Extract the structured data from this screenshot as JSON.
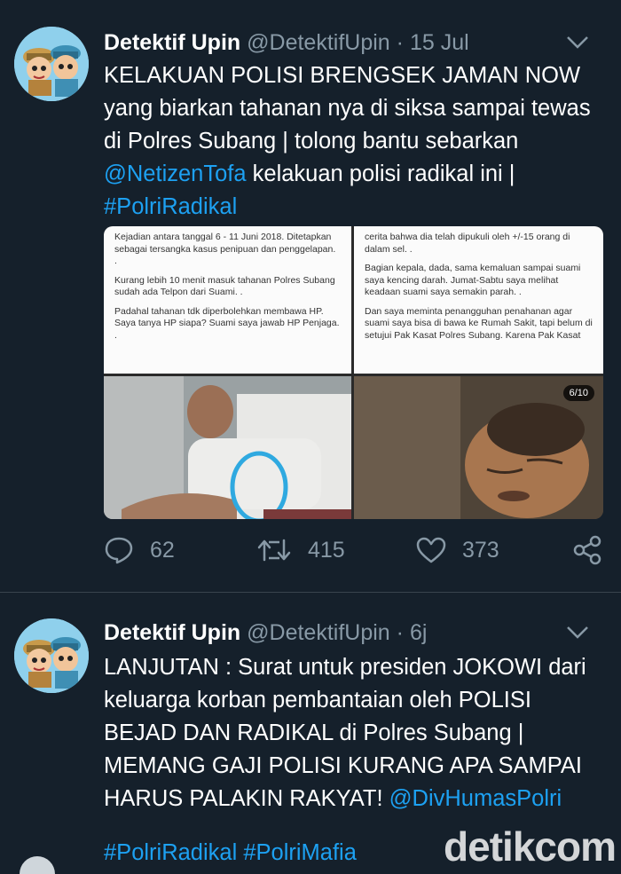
{
  "tweets": [
    {
      "name": "Detektif Upin",
      "handle": "@DetektifUpin",
      "separator": "·",
      "time": "15 Jul",
      "text_parts": {
        "p1": "KELAKUAN POLISI BRENGSEK JAMAN NOW yang biarkan tahanan nya di siksa sampai tewas di Polres Subang | tolong bantu sebarkan ",
        "mention": "@NetizenTofa",
        "p2": " kelakuan polisi radikal ini | ",
        "hashtag": "#PolriRadikal"
      },
      "media": {
        "left_panel": [
          "Kejadian antara tanggal 6 - 11 Juni 2018. Ditetapkan sebagai tersangka kasus penipuan dan penggelapan. .",
          "Kurang lebih 10 menit masuk tahanan Polres Subang sudah ada Telpon dari Suami. .",
          "Padahal tahanan tdk diperbolehkan membawa HP. Saya tanya HP siapa? Suami saya jawab HP Penjaga. ."
        ],
        "right_panel": [
          "cerita bahwa dia telah dipukuli oleh +/-15 orang di dalam sel. .",
          "Bagian kepala, dada, sama kemaluan sampai suami saya kencing darah. Jumat-Sabtu saya melihat keadaan suami saya semakin parah. .",
          "Dan saya meminta penangguhan penahanan agar suami saya bisa di bawa ke Rumah Sakit, tapi belum di setujui Pak Kasat Polres Subang. Karena Pak Kasat"
        ],
        "counter": "6/10"
      },
      "actions": {
        "replies": "62",
        "retweets": "415",
        "likes": "373"
      }
    },
    {
      "name": "Detektif Upin",
      "handle": "@DetektifUpin",
      "separator": "·",
      "time": "6j",
      "text_parts": {
        "p1": "LANJUTAN : Surat untuk presiden JOKOWI dari keluarga korban pembantaian oleh POLISI BEJAD DAN RADIKAL di Polres Subang | MEMANG GAJI POLISI KURANG APA SAMPAI HARUS PALAKIN RAKYAT! ",
        "mention": "@DivHumasPolri"
      },
      "hashtags": "#PolriRadikal #PolriMafia"
    }
  ],
  "watermark": "detikcom",
  "icons": [
    "reply-icon",
    "retweet-icon",
    "like-icon",
    "share-icon",
    "chevron-down-icon"
  ],
  "colors": {
    "background": "#15202b",
    "link": "#1da1f2",
    "muted": "#8899a6",
    "divider": "#38444d"
  }
}
